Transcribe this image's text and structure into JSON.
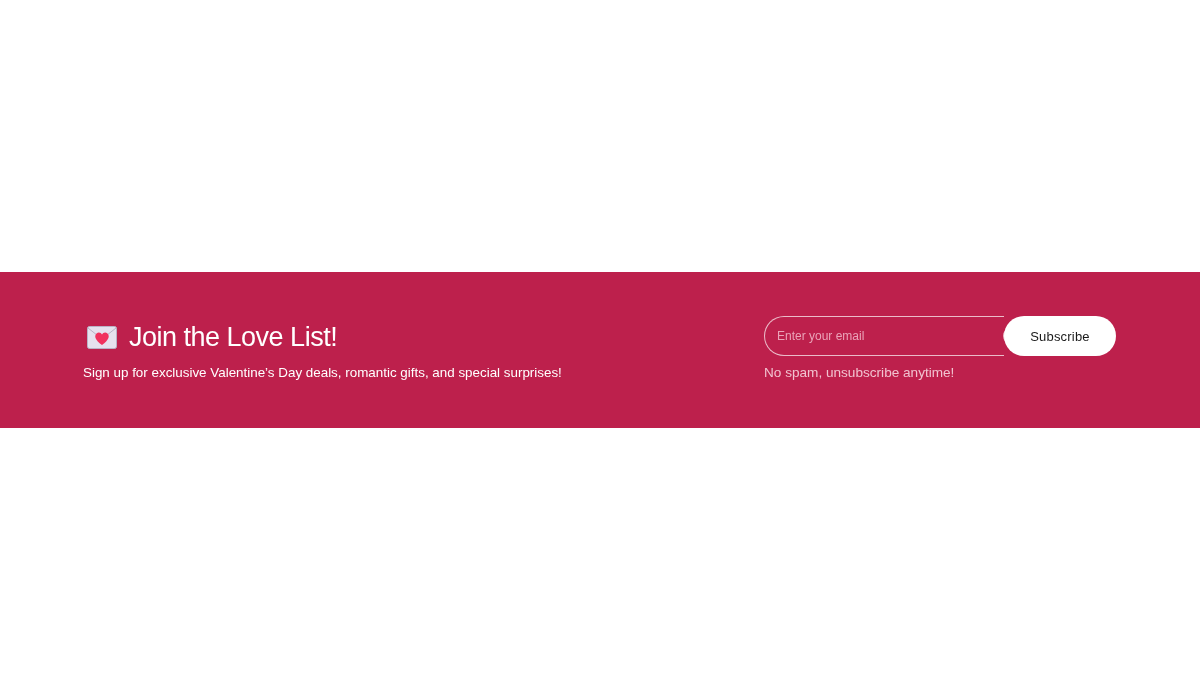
{
  "banner": {
    "title": "Join the Love List!",
    "description": "Sign up for exclusive Valentine’s Day deals, romantic gifts, and special surprises!"
  },
  "signup": {
    "email_field": {
      "placeholder": "Enter your email"
    },
    "button": "Subscribe",
    "note": "No spam, unsubscribe anytime!"
  }
}
